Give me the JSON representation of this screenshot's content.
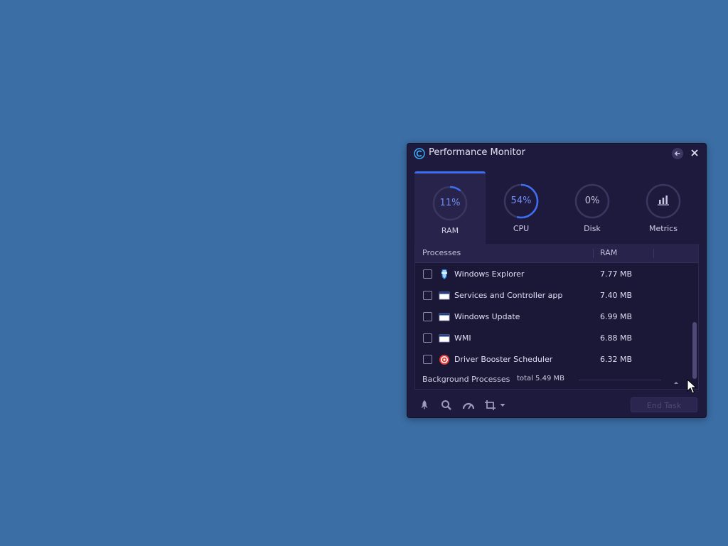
{
  "window": {
    "title": "Performance Monitor",
    "logo_icon": "ccleaner-logo-icon",
    "back_icon": "back-arrow-icon",
    "close_icon": "close-icon"
  },
  "tabs": [
    {
      "id": "ram",
      "label": "RAM",
      "value": "11%",
      "percent": 11,
      "active": true
    },
    {
      "id": "cpu",
      "label": "CPU",
      "value": "54%",
      "percent": 54,
      "active": false
    },
    {
      "id": "disk",
      "label": "Disk",
      "value": "0%",
      "percent": 0,
      "active": false
    },
    {
      "id": "metrics",
      "label": "Metrics",
      "icon": "bar-chart-icon",
      "active": false
    }
  ],
  "table": {
    "columns": {
      "processes": "Processes",
      "ram": "RAM"
    },
    "rows": [
      {
        "name": "Windows Explorer",
        "ram": "7.77 MB",
        "icon": "windows-explorer-icon",
        "checked": false
      },
      {
        "name": "Services and Controller app",
        "ram": "7.40 MB",
        "icon": "app-window-icon",
        "checked": false
      },
      {
        "name": "Windows Update",
        "ram": "6.99 MB",
        "icon": "app-window-icon",
        "checked": false
      },
      {
        "name": "WMI",
        "ram": "6.88 MB",
        "icon": "app-window-icon",
        "checked": false
      },
      {
        "name": "Driver Booster Scheduler",
        "ram": "6.32 MB",
        "icon": "driver-booster-icon",
        "checked": false
      }
    ],
    "background": {
      "label": "Background Processes",
      "total": "total 5.49 MB"
    }
  },
  "toolbar": {
    "icons": [
      "rocket-icon",
      "search-icon",
      "speedometer-icon",
      "crop-icon"
    ],
    "end_task_label": "End Task"
  },
  "colors": {
    "desktop": "#3b6ea5",
    "window": "#1e1a3d",
    "accent": "#3d6ff0"
  }
}
